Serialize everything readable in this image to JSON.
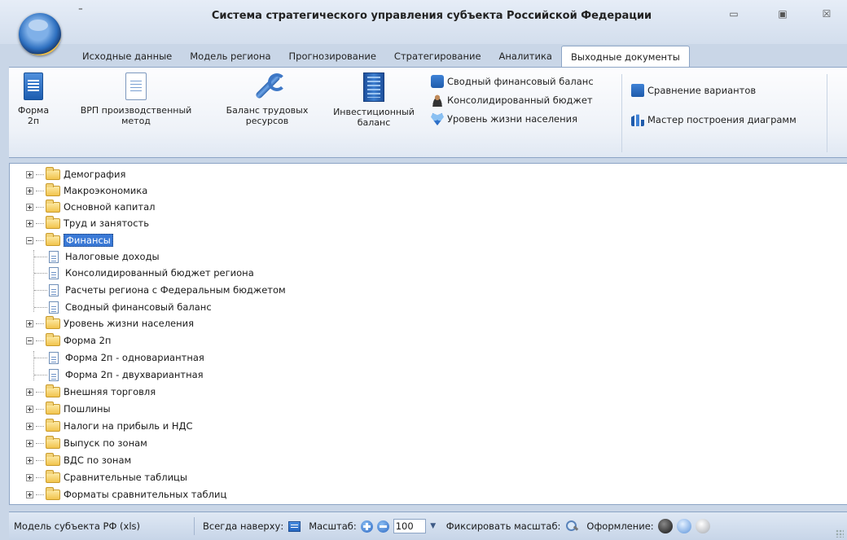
{
  "window": {
    "title": "Система стратегического управления субъекта Российской Федерации",
    "qat_symbol": "⁼",
    "controls": {
      "minimize": "▭",
      "maximize": "▣",
      "close": "☒"
    }
  },
  "tabs": [
    {
      "label": "Исходные данные",
      "active": false
    },
    {
      "label": "Модель региона",
      "active": false
    },
    {
      "label": "Прогнозирование",
      "active": false
    },
    {
      "label": "Стратегирование",
      "active": false
    },
    {
      "label": "Аналитика",
      "active": false
    },
    {
      "label": "Выходные документы",
      "active": true
    }
  ],
  "ribbon": {
    "forma2p": {
      "line1": "Форма",
      "line2": "2п",
      "icon": "blue-document-icon"
    },
    "vrp": {
      "line1": "ВРП производственный",
      "line2": "метод",
      "icon": "document-icon"
    },
    "labor": {
      "line1": "Баланс трудовых",
      "line2": "ресурсов",
      "icon": "wrench-icon"
    },
    "invest": {
      "line1": "Инвестиционный",
      "line2": "баланс",
      "icon": "building-icon"
    },
    "small": [
      {
        "label": "Сводный финансовый баланс",
        "icon": "briefcase-icon"
      },
      {
        "label": "Консолидированный бюджет",
        "icon": "user-icon"
      },
      {
        "label": "Уровень жизни населения",
        "icon": "heart-icon"
      }
    ],
    "right": [
      {
        "label": "Сравнение вариантов",
        "icon": "compare-icon"
      },
      {
        "label": "Мастер построения диаграмм",
        "icon": "chart-icon"
      }
    ]
  },
  "tree": [
    {
      "label": "Демография",
      "type": "folder",
      "expanded": false
    },
    {
      "label": "Макроэкономика",
      "type": "folder",
      "expanded": false
    },
    {
      "label": "Основной капитал",
      "type": "folder",
      "expanded": false
    },
    {
      "label": "Труд и занятость",
      "type": "folder",
      "expanded": false
    },
    {
      "label": "Финансы",
      "type": "folder",
      "expanded": true,
      "selected": true
    },
    {
      "label": "Налоговые  доходы",
      "type": "file"
    },
    {
      "label": "Консолидированный бюджет региона",
      "type": "file"
    },
    {
      "label": "Расчеты региона с Федеральным бюджетом",
      "type": "file"
    },
    {
      "label": "Сводный финансовый баланс",
      "type": "file"
    },
    {
      "label": "Уровень жизни населения",
      "type": "folder",
      "expanded": false
    },
    {
      "label": "Форма 2п",
      "type": "folder",
      "expanded": true
    },
    {
      "label": "Форма 2п - одновариантная",
      "type": "file"
    },
    {
      "label": "Форма 2п - двухвариантная",
      "type": "file"
    },
    {
      "label": "Внешняя торговля",
      "type": "folder",
      "expanded": false
    },
    {
      "label": "Пошлины",
      "type": "folder",
      "expanded": false
    },
    {
      "label": "Налоги на прибыль и НДС",
      "type": "folder",
      "expanded": false
    },
    {
      "label": "Выпуск по зонам",
      "type": "folder",
      "expanded": false
    },
    {
      "label": "ВДС по зонам",
      "type": "folder",
      "expanded": false
    },
    {
      "label": "Сравнительные таблицы",
      "type": "folder",
      "expanded": false
    },
    {
      "label": "Форматы сравнительных таблиц",
      "type": "folder",
      "expanded": false
    }
  ],
  "status": {
    "model": "Модель субъекта РФ (xls)",
    "always_on_top": "Всегда наверху:",
    "scale_label": "Масштаб:",
    "scale_value": "100",
    "fix_scale": "Фиксировать масштаб:",
    "theme_label": "Оформление:",
    "themes": [
      "black",
      "blue",
      "silver"
    ]
  }
}
